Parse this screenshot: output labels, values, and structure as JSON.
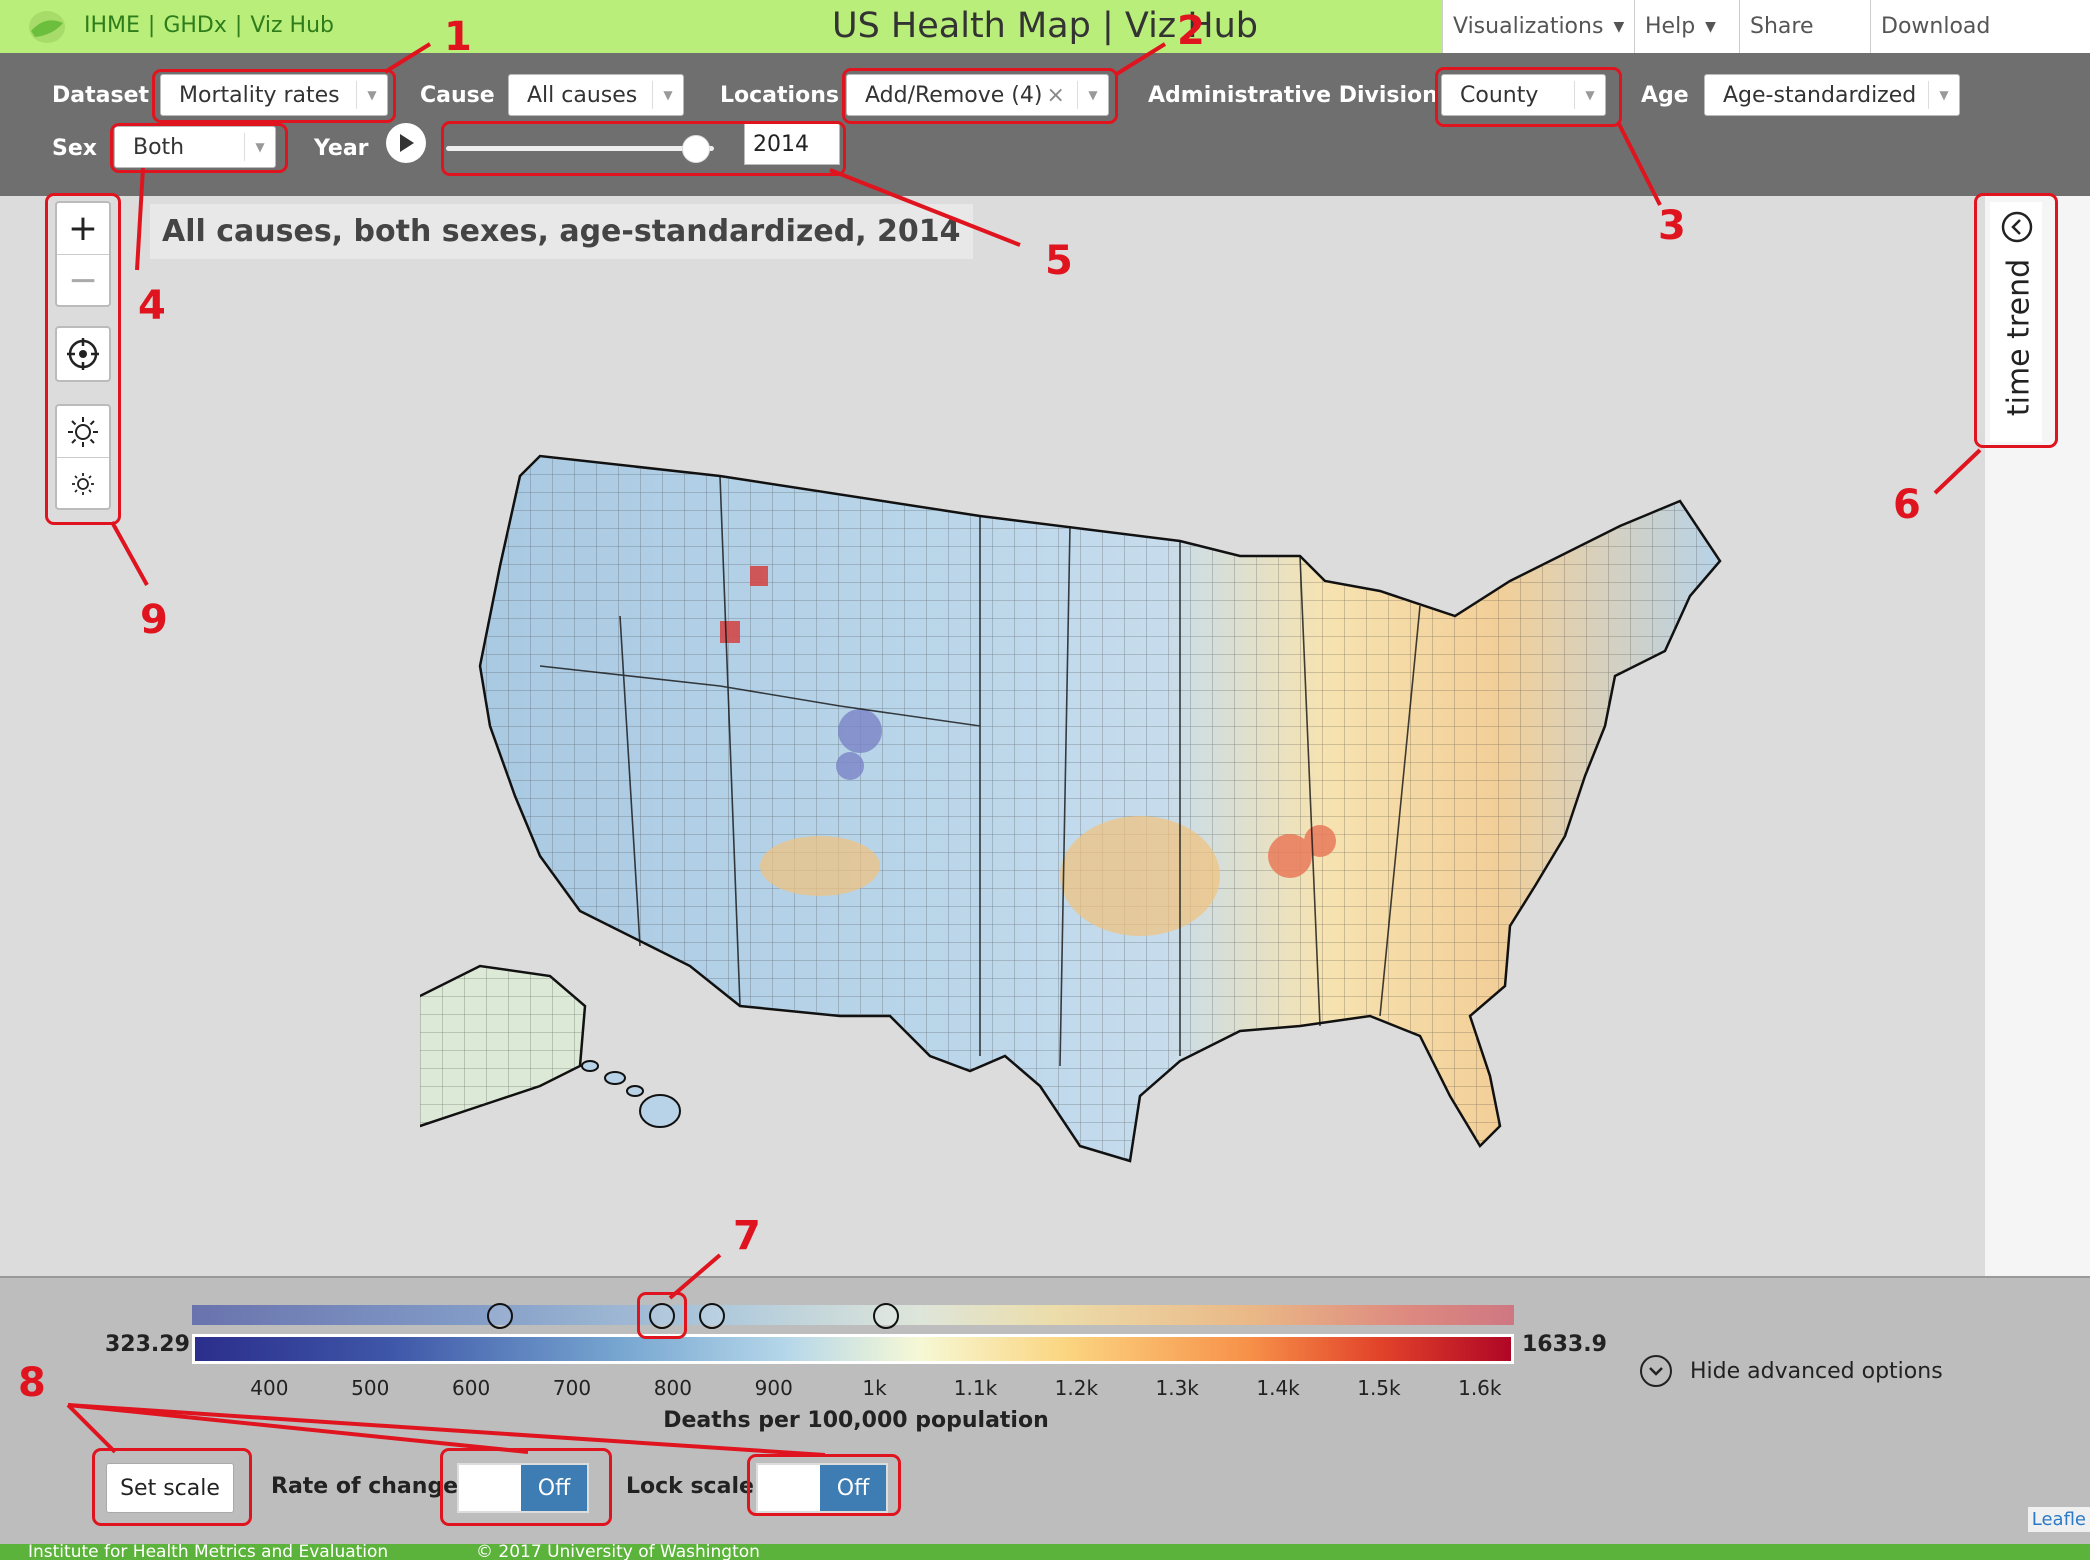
{
  "header": {
    "links": [
      "IHME",
      "GHDx",
      "Viz Hub"
    ],
    "title": "US Health Map | Viz Hub",
    "nav": [
      {
        "label": "Visualizations",
        "has_caret": true
      },
      {
        "label": "Help",
        "has_caret": true
      },
      {
        "label": "Share",
        "has_caret": false
      },
      {
        "label": "Download",
        "has_caret": false
      }
    ],
    "brand_color": "#b9ee7a"
  },
  "controls": {
    "dataset": {
      "label": "Dataset",
      "value": "Mortality rates"
    },
    "cause": {
      "label": "Cause",
      "value": "All causes"
    },
    "locations": {
      "label": "Locations",
      "value": "Add/Remove (4)"
    },
    "admin_division": {
      "label": "Administrative Division",
      "value": "County"
    },
    "age": {
      "label": "Age",
      "value": "Age-standardized"
    },
    "sex": {
      "label": "Sex",
      "value": "Both"
    },
    "year": {
      "label": "Year",
      "value": "2014",
      "slider_position": 0.93
    }
  },
  "map": {
    "title": "All causes, both sexes, age-standardized, 2014",
    "time_trend_label": "time trend",
    "icons": [
      "zoom-in-icon",
      "zoom-out-icon",
      "locate-icon",
      "brightness-up-icon",
      "brightness-down-icon"
    ]
  },
  "legend": {
    "min": "323.29",
    "max": "1633.9",
    "ticks": [
      "400",
      "500",
      "600",
      "700",
      "800",
      "900",
      "1k",
      "1.1k",
      "1.2k",
      "1.3k",
      "1.4k",
      "1.5k",
      "1.6k"
    ],
    "tick_values": [
      400,
      500,
      600,
      700,
      800,
      900,
      1000,
      1100,
      1200,
      1300,
      1400,
      1500,
      1600
    ],
    "unit": "Deaths per 100,000 population",
    "hide_advanced": "Hide advanced options",
    "set_scale": "Set scale",
    "rate_of_change": {
      "label": "Rate of change",
      "value": "Off"
    },
    "lock_scale": {
      "label": "Lock scale",
      "value": "Off"
    },
    "selected_values": [
      628,
      788,
      838,
      1010
    ],
    "leaflet": "Leafle",
    "color_scale": [
      "#2b2e8c",
      "#76a5d0",
      "#f6f8d5",
      "#f79149",
      "#b00626"
    ]
  },
  "footer": {
    "org": "Institute for Health Metrics and Evaluation",
    "copyright": "© 2017 University of Washington"
  },
  "annotations": {
    "labels": [
      "1",
      "2",
      "3",
      "4",
      "5",
      "6",
      "7",
      "8",
      "9"
    ],
    "color": "#e0141e"
  }
}
